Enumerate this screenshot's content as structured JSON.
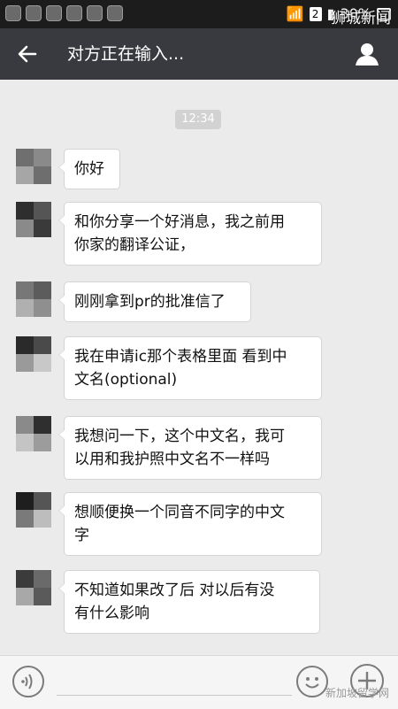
{
  "status_bar": {
    "signal_badge": "2",
    "battery": "30%",
    "watermark": "狮城新闻"
  },
  "header": {
    "title": "对方正在输入..."
  },
  "timestamp": "12:34",
  "messages": [
    {
      "text": "你好"
    },
    {
      "line1": "和你分享一个好消息，我之前用",
      "line2": "你家的翻译公证，"
    },
    {
      "text": "刚刚拿到pr的批准信了"
    },
    {
      "line1": "我在申请ic那个表格里面 看到中",
      "line2": "文名(optional)"
    },
    {
      "line1": "我想问一下，这个中文名，我可",
      "line2": "以用和我护照中文名不一样吗"
    },
    {
      "line1": "想顺便换一个同音不同字的中文",
      "line2": "字"
    },
    {
      "line1": "不知道如果改了后 对以后有没",
      "line2": "有什么影响"
    }
  ],
  "footer": {
    "watermark": "新加坡留学网"
  },
  "icons": {
    "back": "back-arrow-icon",
    "contact": "person-icon",
    "voice": "voice-icon",
    "emoji": "emoji-icon",
    "add": "plus-icon"
  },
  "colors": {
    "titlebar": "#393a3f",
    "chat_background": "#ebebeb",
    "bubble": "#ffffff"
  }
}
